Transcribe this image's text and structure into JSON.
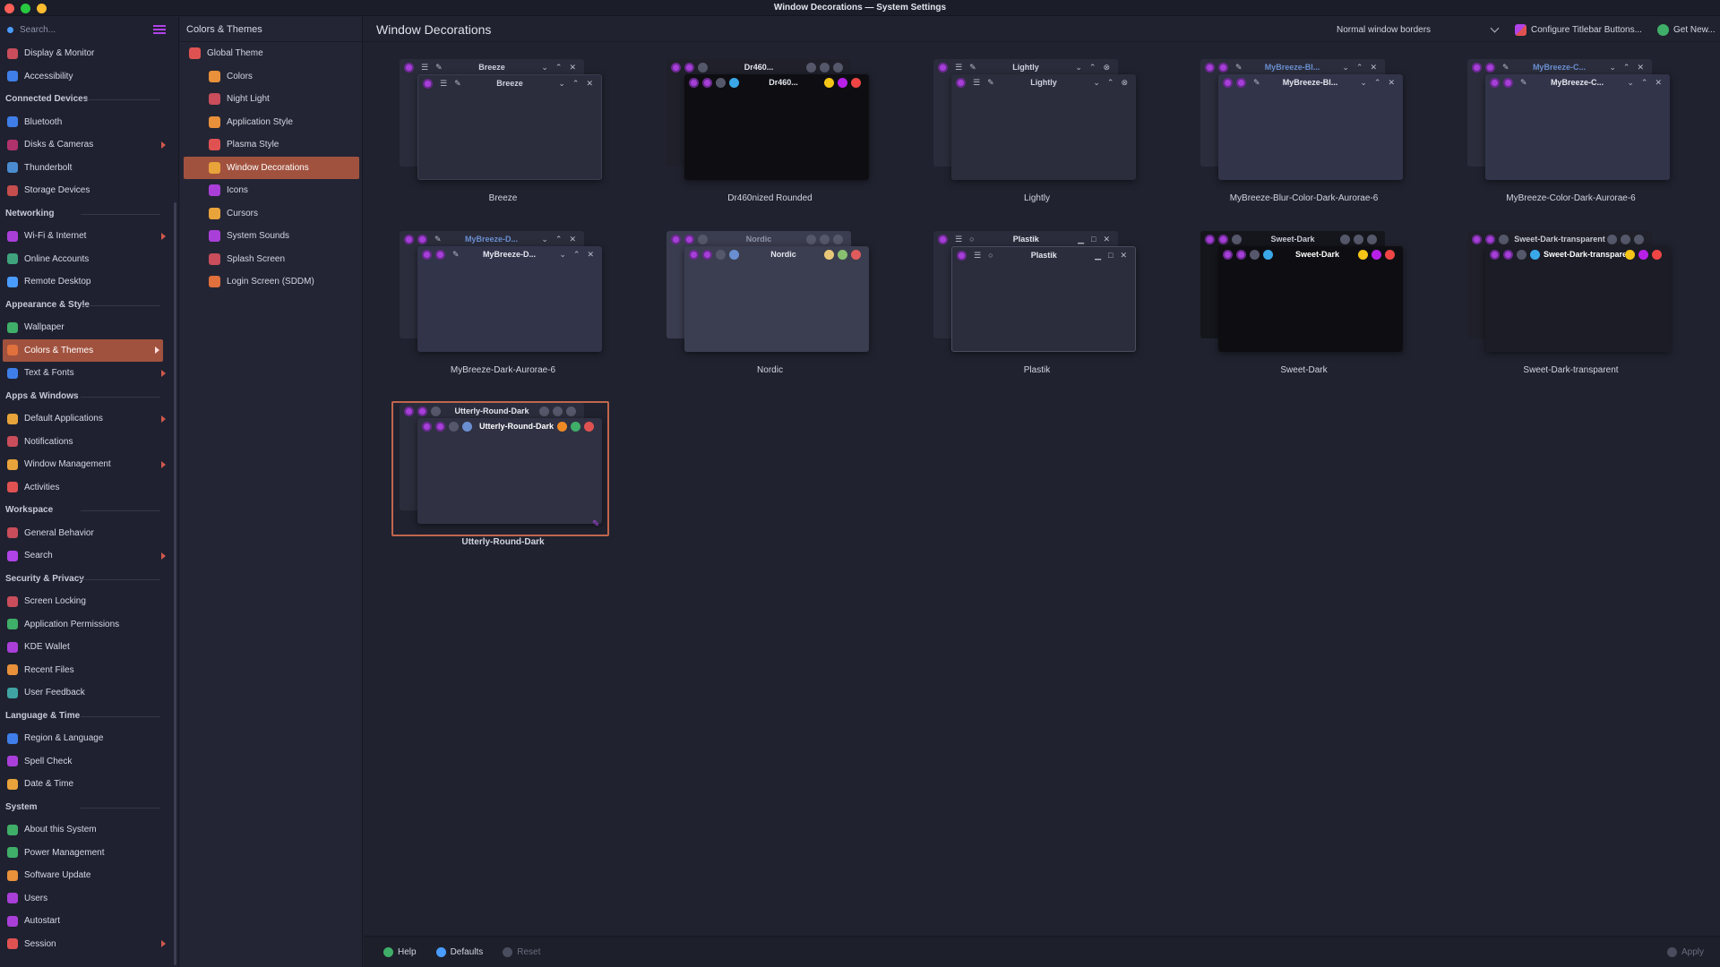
{
  "window": {
    "title": "Window Decorations — System Settings"
  },
  "sidebar": {
    "search_placeholder": "Search...",
    "sections": [
      {
        "type": "item",
        "label": "Display & Monitor",
        "icon": "monitor-icon",
        "color": "#c94d5a"
      },
      {
        "type": "item",
        "label": "Accessibility",
        "icon": "accessibility-icon",
        "color": "#3f7ee8"
      },
      {
        "type": "header",
        "label": "Connected Devices"
      },
      {
        "type": "item",
        "label": "Bluetooth",
        "icon": "bluetooth-icon",
        "color": "#3f7ee8"
      },
      {
        "type": "item",
        "label": "Disks & Cameras",
        "icon": "disks-icon",
        "color": "#b0326a",
        "arrow": true
      },
      {
        "type": "item",
        "label": "Thunderbolt",
        "icon": "thunderbolt-icon",
        "color": "#4a8ccf"
      },
      {
        "type": "item",
        "label": "Storage Devices",
        "icon": "storage-icon",
        "color": "#c44d4d"
      },
      {
        "type": "header",
        "label": "Networking"
      },
      {
        "type": "item",
        "label": "Wi-Fi & Internet",
        "icon": "wifi-icon",
        "color": "#a93fd8",
        "arrow": true
      },
      {
        "type": "item",
        "label": "Online Accounts",
        "icon": "online-accounts-icon",
        "color": "#3fa37e"
      },
      {
        "type": "item",
        "label": "Remote Desktop",
        "icon": "remote-desktop-icon",
        "color": "#4a9cff"
      },
      {
        "type": "header",
        "label": "Appearance & Style"
      },
      {
        "type": "item",
        "label": "Wallpaper",
        "icon": "wallpaper-icon",
        "color": "#3fae68"
      },
      {
        "type": "item",
        "label": "Colors & Themes",
        "icon": "colors-themes-icon",
        "color": "#e0703c",
        "arrow": true,
        "active": true
      },
      {
        "type": "item",
        "label": "Text & Fonts",
        "icon": "fonts-icon",
        "color": "#3f7ee8",
        "arrow": true
      },
      {
        "type": "header",
        "label": "Apps & Windows"
      },
      {
        "type": "item",
        "label": "Default Applications",
        "icon": "star-icon",
        "color": "#e8a33a",
        "arrow": true
      },
      {
        "type": "item",
        "label": "Notifications",
        "icon": "bell-icon",
        "color": "#c94d5a"
      },
      {
        "type": "item",
        "label": "Window Management",
        "icon": "window-management-icon",
        "color": "#e8a33a",
        "arrow": true
      },
      {
        "type": "item",
        "label": "Activities",
        "icon": "activities-icon",
        "color": "#e05252"
      },
      {
        "type": "header",
        "label": "Workspace"
      },
      {
        "type": "item",
        "label": "General Behavior",
        "icon": "general-behavior-icon",
        "color": "#c94d5a"
      },
      {
        "type": "item",
        "label": "Search",
        "icon": "search-icon",
        "color": "#b043e8",
        "arrow": true
      },
      {
        "type": "header",
        "label": "Security & Privacy"
      },
      {
        "type": "item",
        "label": "Screen Locking",
        "icon": "lock-icon",
        "color": "#c94d5a"
      },
      {
        "type": "item",
        "label": "Application Permissions",
        "icon": "shield-icon",
        "color": "#3fae68"
      },
      {
        "type": "item",
        "label": "KDE Wallet",
        "icon": "wallet-icon",
        "color": "#a93fd8"
      },
      {
        "type": "item",
        "label": "Recent Files",
        "icon": "clock-icon",
        "color": "#e8903a"
      },
      {
        "type": "item",
        "label": "User Feedback",
        "icon": "feedback-icon",
        "color": "#3fa3a3"
      },
      {
        "type": "header",
        "label": "Language & Time"
      },
      {
        "type": "item",
        "label": "Region & Language",
        "icon": "globe-icon",
        "color": "#3f7ee8"
      },
      {
        "type": "item",
        "label": "Spell Check",
        "icon": "spell-check-icon",
        "color": "#a93fd8"
      },
      {
        "type": "item",
        "label": "Date & Time",
        "icon": "clock-icon",
        "color": "#e8a33a"
      },
      {
        "type": "header",
        "label": "System"
      },
      {
        "type": "item",
        "label": "About this System",
        "icon": "about-icon",
        "color": "#3fae68"
      },
      {
        "type": "item",
        "label": "Power Management",
        "icon": "power-icon",
        "color": "#3fae68"
      },
      {
        "type": "item",
        "label": "Software Update",
        "icon": "update-icon",
        "color": "#e8903a"
      },
      {
        "type": "item",
        "label": "Users",
        "icon": "users-icon",
        "color": "#a93fd8"
      },
      {
        "type": "item",
        "label": "Autostart",
        "icon": "autostart-icon",
        "color": "#a93fd8"
      },
      {
        "type": "item",
        "label": "Session",
        "icon": "session-icon",
        "color": "#e05252",
        "arrow": true
      }
    ]
  },
  "middle": {
    "title": "Colors & Themes",
    "items": [
      {
        "label": "Global Theme",
        "icon": "global-theme-icon",
        "color": "#e05252",
        "level": 0
      },
      {
        "label": "Colors",
        "icon": "colors-icon",
        "color": "#e8903a",
        "level": 1
      },
      {
        "label": "Night Light",
        "icon": "night-light-icon",
        "color": "#c94d5a",
        "level": 1
      },
      {
        "label": "Application Style",
        "icon": "application-style-icon",
        "color": "#e8903a",
        "level": 1
      },
      {
        "label": "Plasma Style",
        "icon": "plasma-style-icon",
        "color": "#e05252",
        "level": 1
      },
      {
        "label": "Window Decorations",
        "icon": "window-decorations-icon",
        "color": "#e8a33a",
        "level": 1,
        "active": true
      },
      {
        "label": "Icons",
        "icon": "icons-icon",
        "color": "#a93fd8",
        "level": 1
      },
      {
        "label": "Cursors",
        "icon": "cursors-icon",
        "color": "#e8a33a",
        "level": 1
      },
      {
        "label": "System Sounds",
        "icon": "sounds-icon",
        "color": "#a93fd8",
        "level": 1
      },
      {
        "label": "Splash Screen",
        "icon": "splash-icon",
        "color": "#c94d5a",
        "level": 1
      },
      {
        "label": "Login Screen (SDDM)",
        "icon": "login-screen-icon",
        "color": "#e0703c",
        "level": 1
      }
    ]
  },
  "main": {
    "title": "Window Decorations",
    "border_size": "Normal window borders",
    "configure_label": "Configure Titlebar Buttons...",
    "get_new_label": "Get New...",
    "decorations": [
      {
        "name": "Breeze",
        "back_title": "Breeze",
        "front_title": "Breeze",
        "style": "breeze"
      },
      {
        "name": "Dr460nized Rounded",
        "back_title": "Dr460...",
        "front_title": "Dr460...",
        "style": "dragon"
      },
      {
        "name": "Lightly",
        "back_title": "Lightly",
        "front_title": "Lightly",
        "style": "lightly"
      },
      {
        "name": "MyBreeze-Blur-Color-Dark-Aurorae-6",
        "back_title": "MyBreeze-Bl...",
        "front_title": "MyBreeze-Bl...",
        "style": "mybreeze"
      },
      {
        "name": "MyBreeze-Color-Dark-Aurorae-6",
        "back_title": "MyBreeze-C...",
        "front_title": "MyBreeze-C...",
        "style": "mybreeze"
      },
      {
        "name": "MyBreeze-Dark-Aurorae-6",
        "back_title": "MyBreeze-D...",
        "front_title": "MyBreeze-D...",
        "style": "mybreeze"
      },
      {
        "name": "Nordic",
        "back_title": "Nordic",
        "front_title": "Nordic",
        "style": "nordic"
      },
      {
        "name": "Plastik",
        "back_title": "Plastik",
        "front_title": "Plastik",
        "style": "plastik"
      },
      {
        "name": "Sweet-Dark",
        "back_title": "Sweet-Dark",
        "front_title": "Sweet-Dark",
        "style": "sweet"
      },
      {
        "name": "Sweet-Dark-transparent",
        "back_title": "Sweet-Dark-transparent",
        "front_title": "Sweet-Dark-transparent",
        "style": "sweettrans"
      },
      {
        "name": "Utterly-Round-Dark",
        "back_title": "Utterly-Round-Dark",
        "front_title": "Utterly-Round-Dark",
        "style": "utterly",
        "selected": true
      }
    ]
  },
  "footer": {
    "help": "Help",
    "defaults": "Defaults",
    "reset": "Reset",
    "apply": "Apply"
  },
  "colors": {
    "accent": "#a1523e",
    "selection_border": "#c1664d",
    "purple_button": "#a63fd8"
  }
}
